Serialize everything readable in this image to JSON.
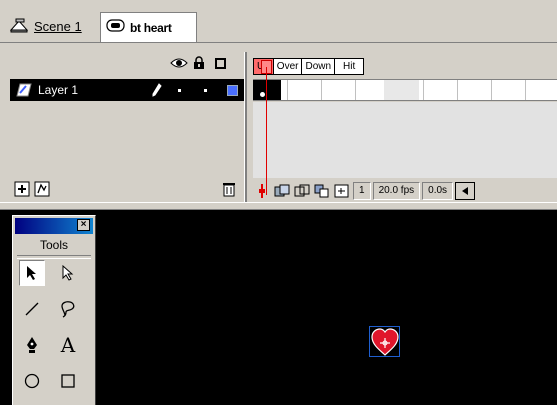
{
  "breadcrumb": {
    "scene_label": "Scene 1",
    "symbol_label": "bt heart"
  },
  "layers": {
    "header_icons": [
      "eye-icon",
      "lock-icon",
      "outline-icon"
    ],
    "items": [
      {
        "name": "Layer 1",
        "selected": true,
        "color": "#4a6fff"
      }
    ]
  },
  "timeline": {
    "frame_labels": [
      "Up",
      "Over",
      "Down",
      "Hit"
    ],
    "active_frame_label": "Up",
    "current_frame": "1",
    "frame_rate": "20.0 fps",
    "elapsed_time": "0.0s"
  },
  "tools": {
    "title": "Tools",
    "items": [
      "arrow-tool",
      "subselect-tool",
      "line-tool",
      "lasso-tool",
      "pen-tool",
      "text-tool",
      "oval-tool",
      "rectangle-tool"
    ],
    "selected": "arrow-tool"
  },
  "stage": {
    "background": "#000000",
    "symbol_color": "#e0162b"
  },
  "colors": {
    "playhead": "#e00000",
    "active_label": "#ff6b6b",
    "selection": "#1f5fd0"
  }
}
